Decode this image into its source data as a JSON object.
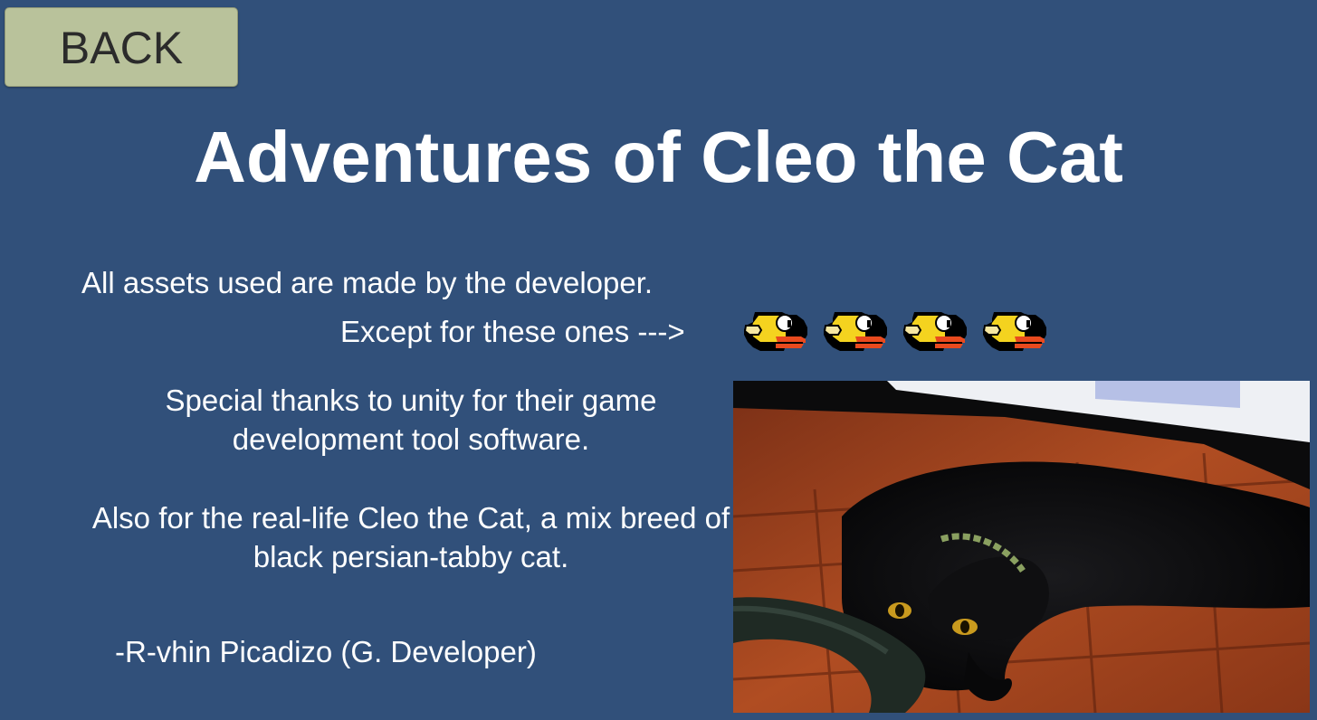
{
  "buttons": {
    "back_label": "BACK"
  },
  "title": "Adventures of Cleo the Cat",
  "credits": {
    "assets_line": "All assets used are made by the developer.",
    "except_line": "Except for these ones --->",
    "thanks_text": "Special thanks to unity for their game development tool software.",
    "cleo_text": "Also for the real-life Cleo the Cat, a mix breed of black persian-tabby cat.",
    "signature": "-R-vhin Picadizo (G. Developer)"
  },
  "icons": {
    "bird": "flappy-bird-sprite-icon",
    "bird_count": 4
  },
  "colors": {
    "background": "#31507a",
    "button": "#b9c29b",
    "text": "#ffffff"
  }
}
